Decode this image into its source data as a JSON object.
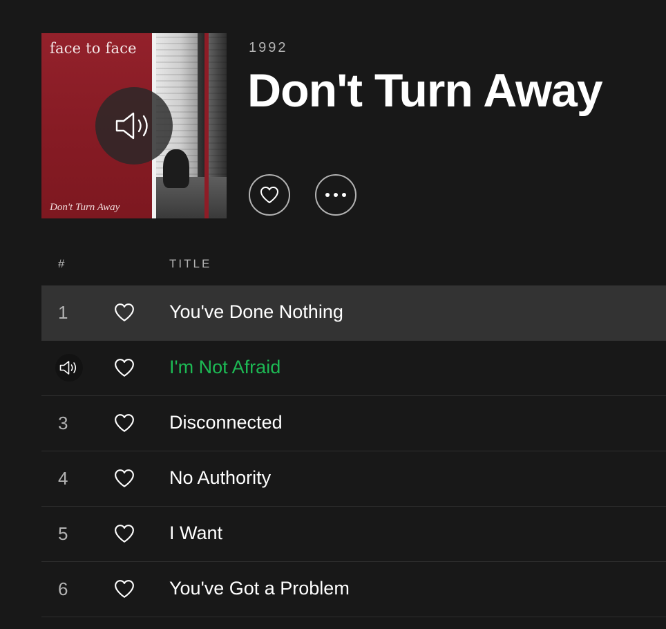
{
  "album": {
    "year": "1992",
    "title": "Don't Turn Away",
    "cover": {
      "band_text": "face to face",
      "album_text": "Don't Turn Away",
      "overlay_icon": "speaker-icon"
    },
    "actions": {
      "like_icon": "heart-outline-icon",
      "more_icon": "ellipsis-icon"
    }
  },
  "tracklist": {
    "columns": {
      "number": "#",
      "title": "TITLE"
    },
    "tracks": [
      {
        "number": "1",
        "title": "You've Done Nothing",
        "state": "hover"
      },
      {
        "number": "2",
        "title": "I'm Not Afraid",
        "state": "playing"
      },
      {
        "number": "3",
        "title": "Disconnected",
        "state": "normal"
      },
      {
        "number": "4",
        "title": "No Authority",
        "state": "normal"
      },
      {
        "number": "5",
        "title": "I Want",
        "state": "normal"
      },
      {
        "number": "6",
        "title": "You've Got a Problem",
        "state": "normal"
      }
    ]
  },
  "colors": {
    "background": "#181818",
    "row_hover": "#333333",
    "playing_accent": "#1db954",
    "muted_text": "#b3b3b3",
    "cover_red": "#8e1c26"
  }
}
